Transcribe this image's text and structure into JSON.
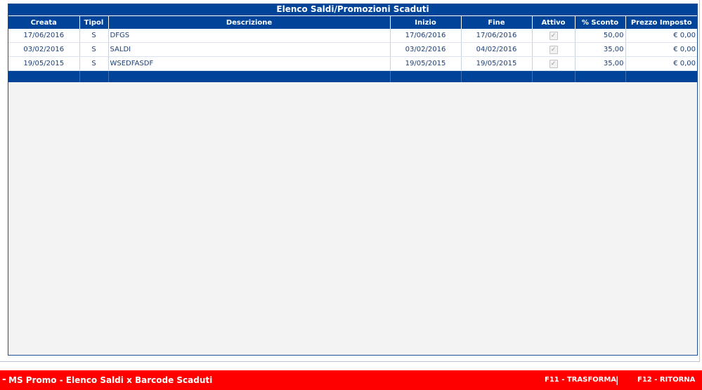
{
  "panel": {
    "title": "Elenco Saldi/Promozioni Scaduti"
  },
  "columns": {
    "creata": "Creata",
    "tipo": "Tipol",
    "descrizione": "Descrizione",
    "inizio": "Inizio",
    "fine": "Fine",
    "attivo": "Attivo",
    "sconto": "% Sconto",
    "prezzo": "Prezzo Imposto"
  },
  "rows": [
    {
      "creata": "17/06/2016",
      "tipo": "S",
      "descrizione": "DFGS",
      "inizio": "17/06/2016",
      "fine": "17/06/2016",
      "attivo": true,
      "sconto": "50,00",
      "prezzo": "€ 0,00"
    },
    {
      "creata": "03/02/2016",
      "tipo": "S",
      "descrizione": "SALDI",
      "inizio": "03/02/2016",
      "fine": "04/02/2016",
      "attivo": true,
      "sconto": "35,00",
      "prezzo": "€ 0,00"
    },
    {
      "creata": "19/05/2015",
      "tipo": "S",
      "descrizione": "WSEDFASDF",
      "inizio": "19/05/2015",
      "fine": "19/05/2015",
      "attivo": true,
      "sconto": "35,00",
      "prezzo": "€ 0,00"
    }
  ],
  "footer": {
    "marker": "-",
    "title": "MS Promo - Elenco Saldi x Barcode Scaduti",
    "f11": "F11 - TRASFORMA",
    "separator": "|",
    "f12": "F12 - RITORNA"
  },
  "colors": {
    "header_blue": "#00449a",
    "footer_red": "#ff0000",
    "text_blue": "#1c3e73"
  },
  "icons": {
    "checkbox": "check-icon"
  }
}
